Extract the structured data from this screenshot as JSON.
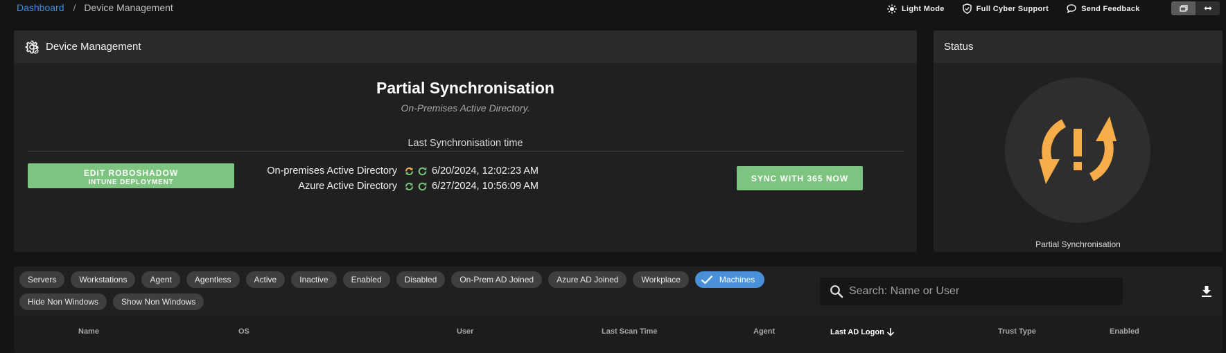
{
  "breadcrumb": {
    "home": "Dashboard",
    "separator": "/",
    "current": "Device Management"
  },
  "top_actions": {
    "light_mode": "Light Mode",
    "cyber_support": "Full Cyber Support",
    "send_feedback": "Send Feedback"
  },
  "device_card": {
    "title": "Device Management",
    "sync_title": "Partial Synchronisation",
    "sync_subtitle": "On-Premises Active Directory.",
    "last_sync_label": "Last Synchronisation time",
    "edit_button": {
      "line1": "EDIT ROBOSHADOW",
      "line2": "INTUNE DEPLOYMENT"
    },
    "sync_rows": [
      {
        "label": "On-premises Active Directory",
        "time": "6/20/2024, 12:02:23 AM"
      },
      {
        "label": "Azure Active Directory",
        "time": "6/27/2024, 10:56:09 AM"
      }
    ],
    "sync_button": "SYNC WITH 365 NOW"
  },
  "status_card": {
    "title": "Status",
    "caption": "Partial Synchronisation",
    "status_icon": "sync-warning-icon"
  },
  "filters": {
    "row1": [
      "Servers",
      "Workstations",
      "Agent",
      "Agentless",
      "Active",
      "Inactive",
      "Enabled",
      "Disabled",
      "On-Prem AD Joined",
      "Azure AD Joined",
      "Workplace",
      "Machines"
    ],
    "row2": [
      "Hide Non Windows",
      "Show Non Windows"
    ],
    "active": "Machines"
  },
  "search": {
    "placeholder": "Search: Name or User"
  },
  "table": {
    "columns": [
      "Name",
      "OS",
      "User",
      "Last Scan Time",
      "Agent",
      "Last AD Logon",
      "Trust Type",
      "Enabled"
    ],
    "sorted_column": "Last AD Logon"
  },
  "colors": {
    "accent_green": "#7cc47f",
    "accent_blue": "#4a90d9",
    "warning_orange": "#f7ad4a",
    "link_blue": "#3d8ee0"
  }
}
